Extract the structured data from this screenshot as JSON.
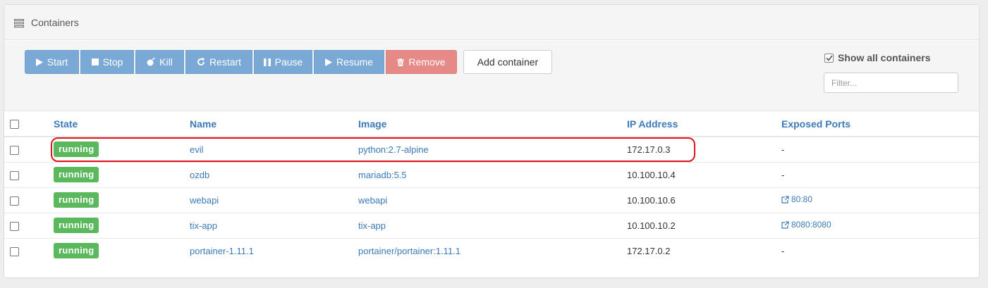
{
  "panel": {
    "title": "Containers",
    "title_icon": "list-icon"
  },
  "toolbar": {
    "start": "Start",
    "stop": "Stop",
    "kill": "Kill",
    "restart": "Restart",
    "pause": "Pause",
    "resume": "Resume",
    "remove": "Remove",
    "add_container": "Add container",
    "show_all": "Show all containers",
    "filter_placeholder": "Filter..."
  },
  "table": {
    "headers": [
      "State",
      "Name",
      "Image",
      "IP Address",
      "Exposed Ports"
    ],
    "rows": [
      {
        "state": "running",
        "name": "evil",
        "image": "python:2.7-alpine",
        "ip": "172.17.0.3",
        "ports": "-"
      },
      {
        "state": "running",
        "name": "ozdb",
        "image": "mariadb:5.5",
        "ip": "10.100.10.4",
        "ports": "-"
      },
      {
        "state": "running",
        "name": "webapi",
        "image": "webapi",
        "ip": "10.100.10.6",
        "ports": "80:80"
      },
      {
        "state": "running",
        "name": "tix-app",
        "image": "tix-app",
        "ip": "10.100.10.2",
        "ports": "8080:8080"
      },
      {
        "state": "running",
        "name": "portainer-1.11.1",
        "image": "portainer/portainer:1.11.1",
        "ip": "172.17.0.2",
        "ports": "-"
      }
    ]
  },
  "colors": {
    "primary_button": "#7aa9d6",
    "danger_button": "#e58a87",
    "running_badge": "#5cb85c",
    "link": "#3b7ab8",
    "highlight": "#e0141a"
  }
}
